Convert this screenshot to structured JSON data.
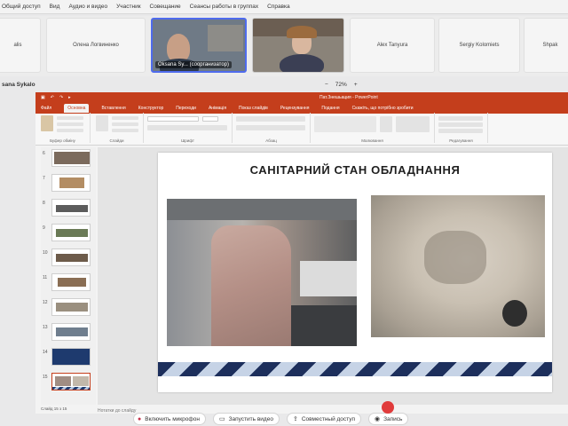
{
  "menubar": {
    "items": [
      "Общий доступ",
      "Вид",
      "Аудио и видео",
      "Участник",
      "Совещание",
      "Сеансы работы в группах",
      "Справка"
    ]
  },
  "participants": {
    "tiles": [
      {
        "name": "alis",
        "type": "name"
      },
      {
        "name": "Олена Логвиненко",
        "type": "name"
      },
      {
        "name": "Oksana Sy... (соорганизатор)",
        "type": "video"
      },
      {
        "name": "",
        "type": "video2"
      },
      {
        "name": "Alex Tanyura",
        "type": "name"
      },
      {
        "name": "Sergiy Kolomiets",
        "type": "name"
      },
      {
        "name": "Shpak",
        "type": "name"
      }
    ]
  },
  "presenter_label": "sana Sykalo",
  "zoom": {
    "minus": "−",
    "value": "72%",
    "plus": "+"
  },
  "ppt": {
    "quick_access": [
      "▣",
      "↶",
      "↷",
      "▸"
    ],
    "document_title": "Пат.Знешьация - PowerPoint",
    "tabs": [
      "Файл",
      "Основна",
      "Вставлення",
      "Конструктор",
      "Переходи",
      "Анімація",
      "Показ слайдів",
      "Рецензування",
      "Подання",
      "Скажіть, що потрібно зробити"
    ],
    "active_tab_index": 1,
    "ribbon_groups": [
      "Буфер обміну",
      "Слайди",
      "Шрифт",
      "Абзац",
      "Малювання",
      "Редагування"
    ],
    "slide_numbers": [
      "6",
      "7",
      "8",
      "9",
      "10",
      "11",
      "12",
      "13",
      "14",
      "15"
    ],
    "selected_slide": "15",
    "slide": {
      "title": "САНІТАРНИЙ СТАН ОБЛАДНАННЯ"
    },
    "notes_placeholder": "Нотатки до слайду",
    "status_text": "Слайд 15 з 15"
  },
  "bottombar": {
    "mic": "Включить микрофон",
    "video": "Запустить видео",
    "share": "Совместный доступ",
    "record": "Запись"
  },
  "colors": {
    "ppt_accent": "#c43e1c",
    "hazard_dark": "#1d2f5c",
    "hazard_light": "#c6d3e6",
    "teams_accent": "#4f6bed"
  }
}
